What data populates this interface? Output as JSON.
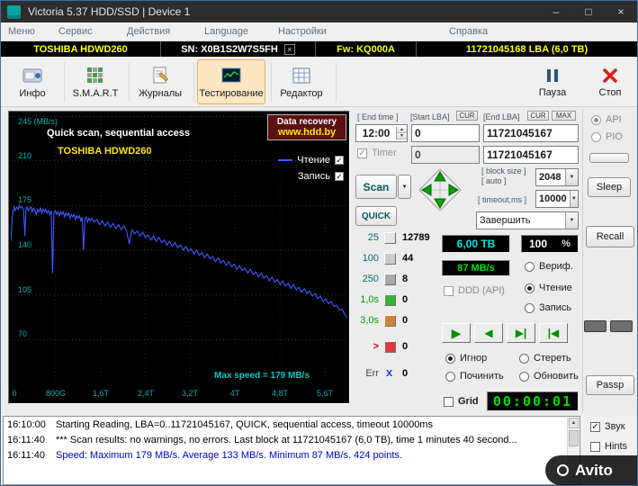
{
  "window": {
    "title": "Victoria 5.37 HDD/SSD | Device 1",
    "minimize": "–",
    "maximize": "□",
    "close": "×"
  },
  "menu": {
    "items": [
      "Меню",
      "Сервис",
      "Действия",
      "Language",
      "Настройки",
      "Справка"
    ]
  },
  "infobar": {
    "model": "TOSHIBA HDWD260",
    "serial": "SN: X0B1S2W7S5FH",
    "close": "×",
    "firmware": "Fw: KQ000A",
    "capacity": "11721045168 LBA (6,0 TB)"
  },
  "toolbar": {
    "buttons": [
      {
        "label": "Инфо"
      },
      {
        "label": "S.M.A.R.T"
      },
      {
        "label": "Журналы"
      },
      {
        "label": "Тестирование"
      },
      {
        "label": "Редактор"
      },
      {
        "label": "Пауза"
      },
      {
        "label": "Стоп"
      }
    ]
  },
  "graph": {
    "title": "Quick scan, sequential access",
    "subtitle": "TOSHIBA HDWD260",
    "watermark_line1": "Data recovery",
    "watermark_line2": "www.hdd.by",
    "legend_read": "Чтение",
    "legend_write": "Запись",
    "max_speed_note": "Max speed = 179 MB/s"
  },
  "chart_data": {
    "type": "line",
    "title": "Quick scan, sequential access",
    "series_name": "Чтение",
    "unit": "MB/s",
    "ylim": [
      35,
      245
    ],
    "gridline_values": [
      245,
      210,
      175,
      140,
      105,
      70
    ],
    "y_labels": [
      "245 (MB/s)",
      "210",
      "175",
      "140",
      "105",
      "70"
    ],
    "x_labels": [
      "0",
      "800G",
      "1,6T",
      "2,4T",
      "3,2T",
      "4T",
      "4,8T",
      "5,6T"
    ],
    "x_tick_fracs": [
      0.012,
      0.133,
      0.267,
      0.4,
      0.533,
      0.667,
      0.8,
      0.933
    ],
    "line_color": "#3d5bff",
    "max_speed": 179,
    "avg_speed": 133,
    "min_speed": 87,
    "points_count": 424,
    "points": [
      [
        0.0,
        147
      ],
      [
        0.003,
        160
      ],
      [
        0.006,
        169
      ],
      [
        0.01,
        174
      ],
      [
        0.014,
        171
      ],
      [
        0.018,
        174
      ],
      [
        0.022,
        172
      ],
      [
        0.026,
        175
      ],
      [
        0.03,
        173
      ],
      [
        0.034,
        174
      ],
      [
        0.038,
        171
      ],
      [
        0.042,
        151
      ],
      [
        0.045,
        172
      ],
      [
        0.048,
        174
      ],
      [
        0.052,
        171
      ],
      [
        0.056,
        173
      ],
      [
        0.06,
        174
      ],
      [
        0.064,
        170
      ],
      [
        0.068,
        173
      ],
      [
        0.072,
        171
      ],
      [
        0.076,
        168
      ],
      [
        0.08,
        172
      ],
      [
        0.084,
        170
      ],
      [
        0.088,
        173
      ],
      [
        0.092,
        169
      ],
      [
        0.096,
        172
      ],
      [
        0.1,
        170
      ],
      [
        0.104,
        172
      ],
      [
        0.108,
        169
      ],
      [
        0.112,
        171
      ],
      [
        0.116,
        168
      ],
      [
        0.12,
        171
      ],
      [
        0.124,
        122
      ],
      [
        0.128,
        169
      ],
      [
        0.132,
        171
      ],
      [
        0.136,
        168
      ],
      [
        0.14,
        170
      ],
      [
        0.144,
        167
      ],
      [
        0.148,
        170
      ],
      [
        0.152,
        168
      ],
      [
        0.156,
        170
      ],
      [
        0.16,
        166
      ],
      [
        0.164,
        169
      ],
      [
        0.168,
        167
      ],
      [
        0.172,
        169
      ],
      [
        0.176,
        165
      ],
      [
        0.18,
        168
      ],
      [
        0.184,
        166
      ],
      [
        0.188,
        168
      ],
      [
        0.192,
        164
      ],
      [
        0.196,
        167
      ],
      [
        0.2,
        165
      ],
      [
        0.204,
        167
      ],
      [
        0.208,
        163
      ],
      [
        0.212,
        166
      ],
      [
        0.216,
        140
      ],
      [
        0.22,
        164
      ],
      [
        0.224,
        166
      ],
      [
        0.228,
        162
      ],
      [
        0.232,
        165
      ],
      [
        0.236,
        163
      ],
      [
        0.24,
        165
      ],
      [
        0.248,
        162
      ],
      [
        0.256,
        164
      ],
      [
        0.264,
        160
      ],
      [
        0.272,
        163
      ],
      [
        0.28,
        159
      ],
      [
        0.288,
        162
      ],
      [
        0.296,
        158
      ],
      [
        0.304,
        161
      ],
      [
        0.312,
        157
      ],
      [
        0.32,
        160
      ],
      [
        0.328,
        156
      ],
      [
        0.336,
        159
      ],
      [
        0.344,
        155
      ],
      [
        0.352,
        145
      ],
      [
        0.36,
        156
      ],
      [
        0.368,
        153
      ],
      [
        0.376,
        155
      ],
      [
        0.384,
        151
      ],
      [
        0.392,
        154
      ],
      [
        0.4,
        150
      ],
      [
        0.408,
        152
      ],
      [
        0.416,
        148
      ],
      [
        0.424,
        151
      ],
      [
        0.432,
        147
      ],
      [
        0.44,
        150
      ],
      [
        0.448,
        146
      ],
      [
        0.456,
        148
      ],
      [
        0.464,
        144
      ],
      [
        0.472,
        147
      ],
      [
        0.48,
        143
      ],
      [
        0.488,
        146
      ],
      [
        0.496,
        142
      ],
      [
        0.504,
        144
      ],
      [
        0.512,
        140
      ],
      [
        0.52,
        143
      ],
      [
        0.528,
        139
      ],
      [
        0.536,
        141
      ],
      [
        0.544,
        137
      ],
      [
        0.552,
        140
      ],
      [
        0.56,
        136
      ],
      [
        0.568,
        138
      ],
      [
        0.576,
        134
      ],
      [
        0.584,
        137
      ],
      [
        0.592,
        133
      ],
      [
        0.6,
        135
      ],
      [
        0.608,
        131
      ],
      [
        0.616,
        134
      ],
      [
        0.624,
        130
      ],
      [
        0.632,
        132
      ],
      [
        0.64,
        128
      ],
      [
        0.648,
        131
      ],
      [
        0.656,
        127
      ],
      [
        0.664,
        129
      ],
      [
        0.672,
        125
      ],
      [
        0.68,
        128
      ],
      [
        0.688,
        124
      ],
      [
        0.696,
        126
      ],
      [
        0.704,
        122
      ],
      [
        0.712,
        125
      ],
      [
        0.72,
        121
      ],
      [
        0.728,
        123
      ],
      [
        0.736,
        119
      ],
      [
        0.744,
        122
      ],
      [
        0.752,
        118
      ],
      [
        0.76,
        120
      ],
      [
        0.768,
        116
      ],
      [
        0.776,
        119
      ],
      [
        0.784,
        115
      ],
      [
        0.792,
        117
      ],
      [
        0.8,
        113
      ],
      [
        0.808,
        116
      ],
      [
        0.816,
        112
      ],
      [
        0.824,
        114
      ],
      [
        0.832,
        110
      ],
      [
        0.84,
        113
      ],
      [
        0.848,
        109
      ],
      [
        0.856,
        111
      ],
      [
        0.864,
        107
      ],
      [
        0.872,
        110
      ],
      [
        0.88,
        106
      ],
      [
        0.888,
        108
      ],
      [
        0.896,
        104
      ],
      [
        0.904,
        106
      ],
      [
        0.912,
        102
      ],
      [
        0.92,
        104
      ],
      [
        0.928,
        100
      ],
      [
        0.936,
        102
      ],
      [
        0.944,
        98
      ],
      [
        0.952,
        100
      ],
      [
        0.96,
        96
      ],
      [
        0.968,
        97
      ],
      [
        0.976,
        93
      ],
      [
        0.984,
        94
      ],
      [
        0.992,
        90
      ],
      [
        1.0,
        87
      ]
    ]
  },
  "controls": {
    "end_time_label": "[ End time ]",
    "start_lba_label": "[Start LBA]",
    "end_lba_label": "[End LBA]",
    "cur_label": "CUR",
    "max_label": "MAX",
    "end_time_value": "12:00",
    "start_lba_value": "0",
    "end_lba_value": "11721045167",
    "timer_label": "Timer",
    "timer_value": "0",
    "lba_mirror_value": "11721045167",
    "block_size_label": "[ block size ]",
    "auto_label": "[ auto ]",
    "block_size_value": "2048",
    "timeout_label": "[ timeout,ms ]",
    "timeout_value": "10000",
    "scan_label": "Scan",
    "quick_label": "QUICK",
    "finish_value": "Завершить",
    "counters": [
      {
        "bucket": "25",
        "value": "12789"
      },
      {
        "bucket": "100",
        "value": "44"
      },
      {
        "bucket": "250",
        "value": "8"
      },
      {
        "bucket": "1,0s",
        "value": "0"
      },
      {
        "bucket": "3,0s",
        "value": "0"
      },
      {
        "bucket": ">",
        "value": "0"
      },
      {
        "bucket": "Err",
        "value": "0"
      }
    ],
    "err_x": "x",
    "size_display": "6,00 TB",
    "percent_value": "100",
    "percent_sign": "%",
    "speed_display": "87 MB/s",
    "radio_verify": "Вериф.",
    "radio_read": "Чтение",
    "radio_write": "Запись",
    "ddd_label": "DDD (API)",
    "radio_ignore": "Игнор",
    "radio_erase": "Стереть",
    "radio_remap": "Починить",
    "radio_refresh": "Обновить",
    "grid_label": "Grid",
    "timer_display": "00:00:01",
    "play_icon": "▶",
    "back_icon": "◀",
    "step_fwd_icon": "▶|",
    "step_back_icon": "|◀"
  },
  "rightpanel": {
    "api_label": "API",
    "pio_label": "PIO",
    "sleep_label": "Sleep",
    "recall_label": "Recall",
    "passp_label": "Passp"
  },
  "log": {
    "entries": [
      {
        "time": "16:10:00",
        "text": "Starting Reading, LBA=0..11721045167, QUICK, sequential access, timeout 10000ms"
      },
      {
        "time": "16:11:40",
        "text": "*** Scan results: no warnings, no errors. Last block at 11721045167 (6,0 TB), time 1 minutes 40 second..."
      },
      {
        "time": "16:11:40",
        "text": "Speed: Maximum 179 MB/s. Average 133 MB/s. Minimum 87 MB/s. 424 points."
      }
    ]
  },
  "bottombar": {
    "sound_label": "Звук",
    "hints_label": "Hints",
    "watermark": "Avito"
  }
}
